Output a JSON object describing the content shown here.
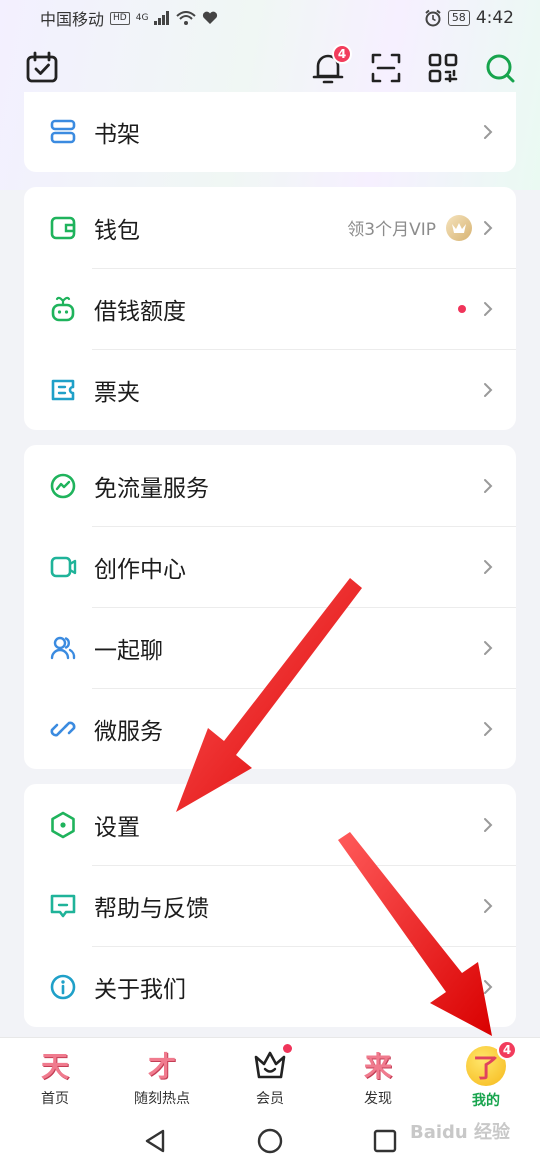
{
  "status_bar": {
    "carrier": "中国移动",
    "hd": "HD",
    "network": "4G",
    "battery": "58",
    "time": "4:42"
  },
  "header": {
    "notification_count": "4"
  },
  "groups": [
    {
      "items": [
        {
          "label": "书架",
          "icon": "bookshelf-icon"
        }
      ]
    },
    {
      "items": [
        {
          "label": "钱包",
          "icon": "wallet-icon",
          "extra": "领3个月VIP"
        },
        {
          "label": "借钱额度",
          "icon": "loan-icon"
        },
        {
          "label": "票夹",
          "icon": "ticket-icon"
        }
      ]
    },
    {
      "items": [
        {
          "label": "免流量服务",
          "icon": "data-free-icon"
        },
        {
          "label": "创作中心",
          "icon": "video-camera-icon"
        },
        {
          "label": "一起聊",
          "icon": "people-icon"
        },
        {
          "label": "微服务",
          "icon": "link-icon"
        }
      ]
    },
    {
      "items": [
        {
          "label": "设置",
          "icon": "settings-hex-icon"
        },
        {
          "label": "帮助与反馈",
          "icon": "feedback-icon"
        },
        {
          "label": "关于我们",
          "icon": "info-icon"
        }
      ]
    }
  ],
  "bottom_nav": {
    "items": [
      {
        "glyph": "天",
        "label": "首页"
      },
      {
        "glyph": "才",
        "label": "随刻热点"
      },
      {
        "glyph": "",
        "label": "会员"
      },
      {
        "glyph": "来",
        "label": "发现"
      },
      {
        "glyph": "了",
        "label": "我的",
        "badge": "4"
      }
    ]
  },
  "watermark": "Baidu 经验",
  "colors": {
    "accent_green": "#17a44d",
    "badge_red": "#f23c5c",
    "arrow_red": "#ee1111"
  }
}
